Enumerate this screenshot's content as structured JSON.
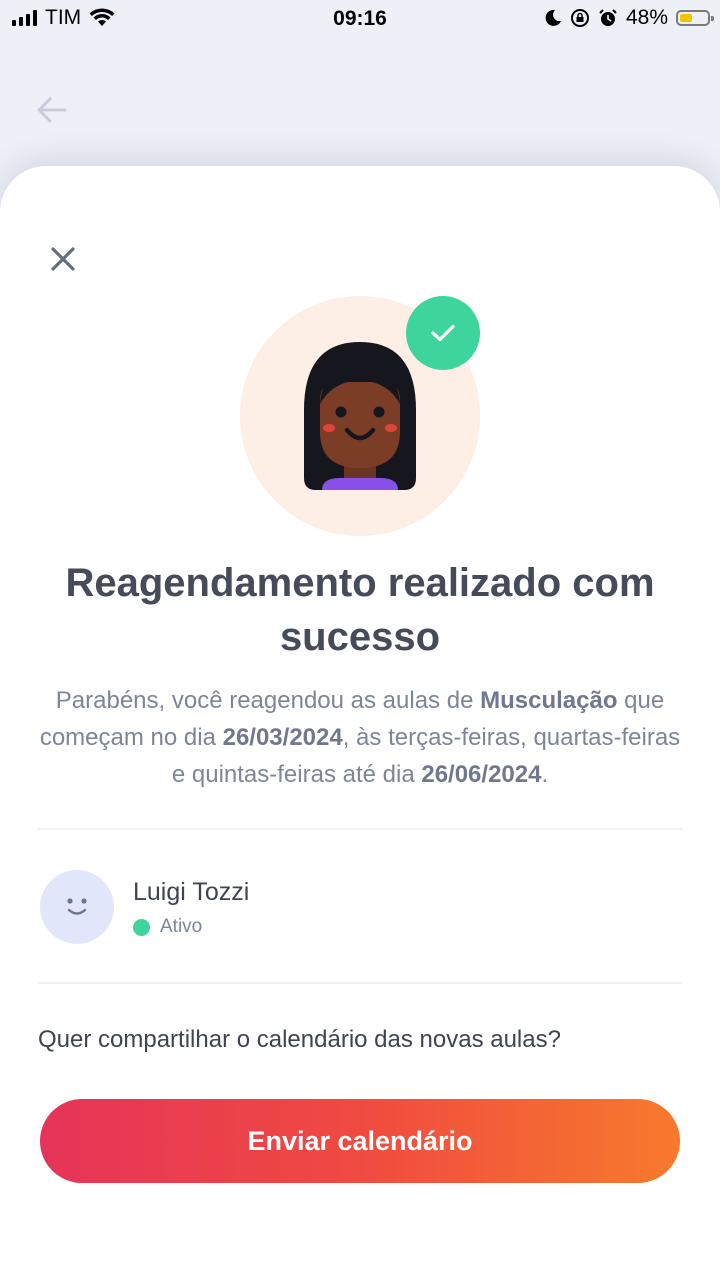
{
  "status_bar": {
    "carrier": "TIM",
    "time": "09:16",
    "battery_percent": "48%",
    "battery_level": 0.48,
    "icons": [
      "signal-icon",
      "wifi-icon",
      "moon-icon",
      "rotation-lock-icon",
      "alarm-icon",
      "battery-icon"
    ]
  },
  "background": {
    "back_icon": "arrow-left-icon"
  },
  "modal": {
    "close_icon": "close-icon",
    "hero_icons": [
      "avatar-illustration-icon",
      "check-icon"
    ],
    "title": "Reagendamento realizado com sucesso",
    "message": {
      "part1": "Parabéns, você reagendou as aulas de ",
      "activity": "Musculação",
      "part2": " que começam no dia ",
      "start_date": "26/03/2024",
      "part3": ", às terças-feiras, quartas-feiras e quintas-feiras até dia ",
      "end_date": "26/06/2024",
      "part4": "."
    },
    "member": {
      "name": "Luigi Tozzi",
      "status": "Ativo",
      "status_color": "#3dd59b",
      "avatar_icon": "smiley-face-icon"
    },
    "share_question": "Quer compartilhar o calendário das novas aulas?",
    "send_button_label": "Enviar calendário",
    "colors": {
      "accent_gradient_start": "#e5345a",
      "accent_gradient_end": "#f77a2c",
      "success": "#3dd59b",
      "hero_background": "#fdeee6"
    }
  }
}
